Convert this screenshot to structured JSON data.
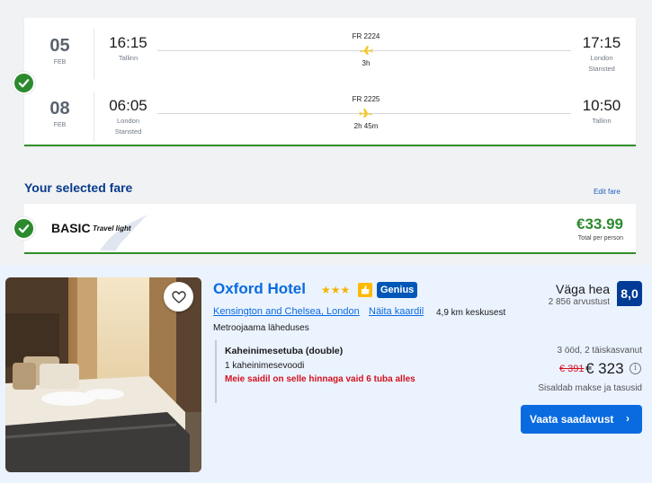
{
  "flights": {
    "outbound": {
      "day": "05",
      "month": "FEB",
      "dep_time": "16:15",
      "dep_city": "Tallinn",
      "flight_no": "FR 2224",
      "duration": "3h",
      "arr_time": "17:15",
      "arr_city_1": "London",
      "arr_city_2": "Stansted"
    },
    "inbound": {
      "day": "08",
      "month": "FEB",
      "dep_time": "06:05",
      "dep_city_1": "London",
      "dep_city_2": "Stansted",
      "flight_no": "FR 2225",
      "duration": "2h 45m",
      "arr_time": "10:50",
      "arr_city": "Tallinn"
    }
  },
  "fare": {
    "section_title": "Your selected fare",
    "edit_label": "Edit fare",
    "name": "BASIC",
    "tagline": "Travel light",
    "price": "€33.99",
    "price_note": "Total per person"
  },
  "hotel": {
    "name": "Oxford Hotel",
    "stars": "★★★",
    "genius_label": "Genius",
    "location_link": "Kensington and Chelsea, London",
    "map_link": "Näita kaardil",
    "distance": "4,9 km keskusest",
    "transport": "Metroojaama läheduses",
    "room_type": "Kaheinimesetuba (double)",
    "bed_type": "1 kaheinimesevoodi",
    "scarcity": "Meie saidil on selle hinnaga vaid 6 tuba alles",
    "rating_word": "Väga hea",
    "reviews": "2 856 arvustust",
    "score": "8,0",
    "stay_info": "3 ööd, 2 täiskasvanut",
    "old_price": "€ 391",
    "new_price": "€ 323",
    "taxes_note": "Sisaldab makse ja tasusid",
    "cta_label": "Vaata saadavust",
    "cta_chevron": "›",
    "info_glyph": "i"
  },
  "colors": {
    "accent_green": "#2c8a2e",
    "ryanair_navy": "#083b8c",
    "booking_blue": "#0a6be0",
    "booking_dark": "#003b95",
    "alert_red": "#d4111e",
    "plane_yellow": "#f1c933"
  },
  "icons": {
    "check": "check-icon",
    "plane": "plane-icon",
    "heart": "heart-icon",
    "thumbs": "thumbs-up-icon",
    "info": "info-icon",
    "chevron": "chevron-right-icon"
  }
}
